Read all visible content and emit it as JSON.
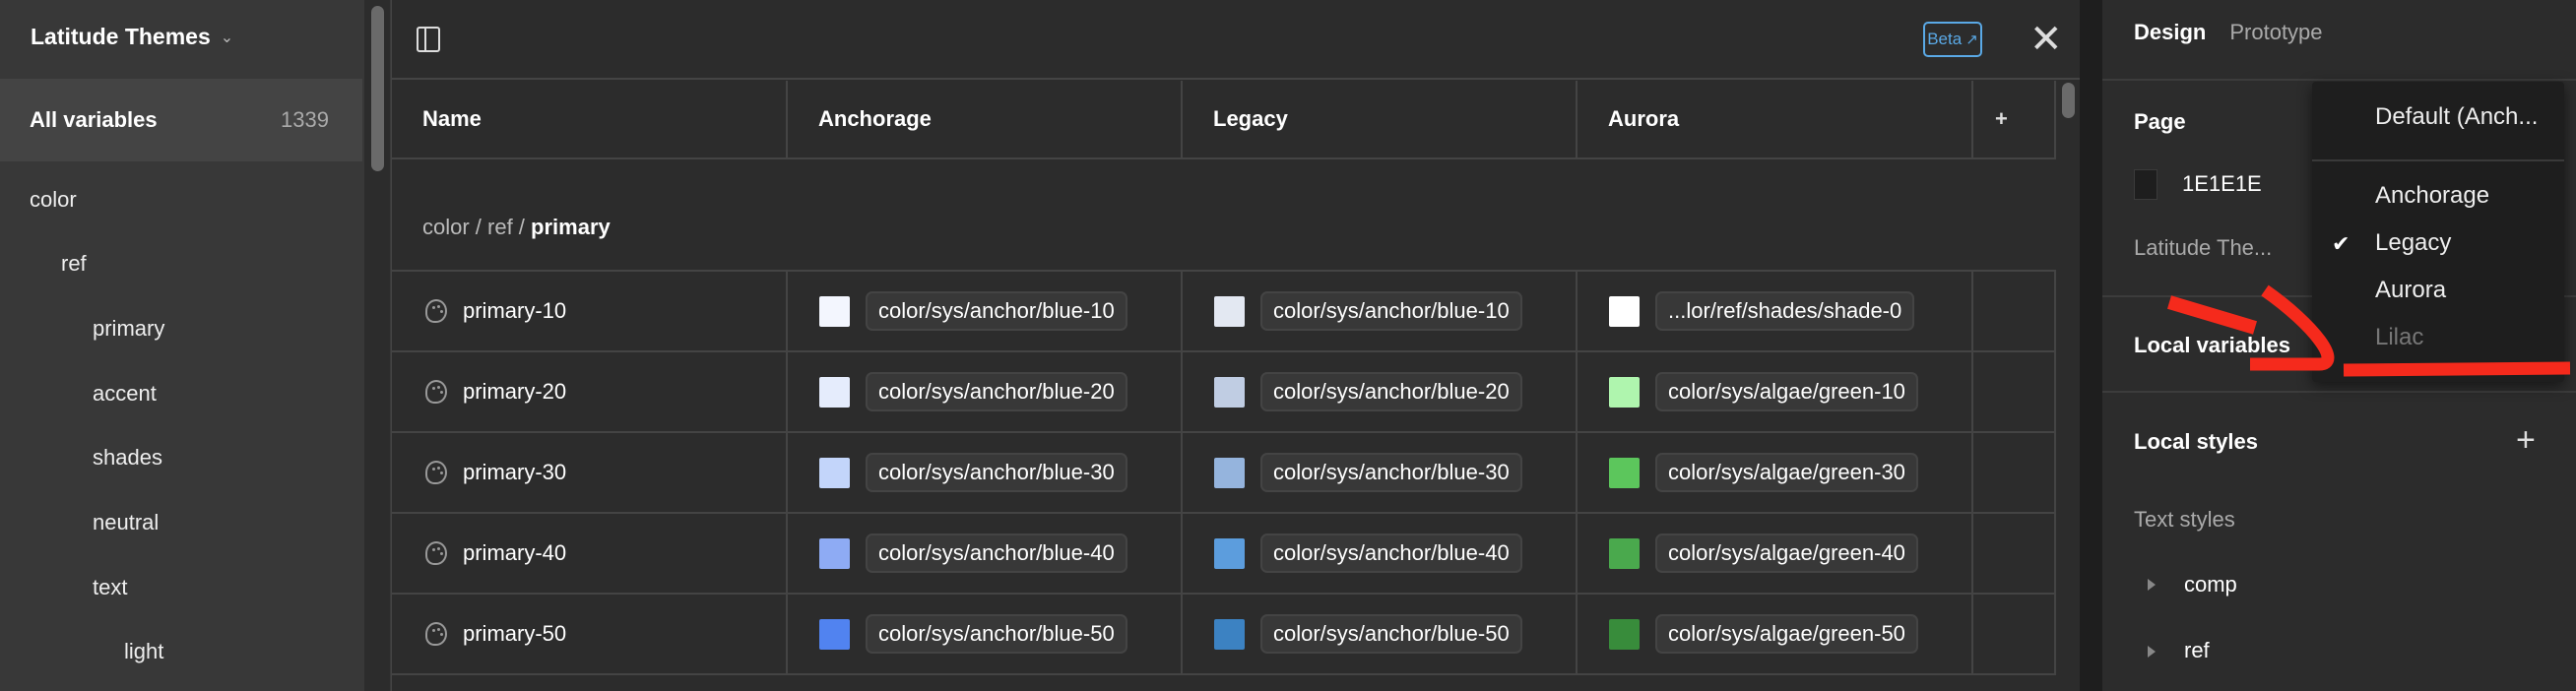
{
  "sidebar": {
    "title": "Latitude Themes",
    "all_variables": {
      "label": "All variables",
      "count": "1339"
    },
    "tree": [
      {
        "label": "color",
        "level": 0
      },
      {
        "label": "ref",
        "level": 1
      },
      {
        "label": "primary",
        "level": 2
      },
      {
        "label": "accent",
        "level": 2
      },
      {
        "label": "shades",
        "level": 2
      },
      {
        "label": "neutral",
        "level": 2
      },
      {
        "label": "text",
        "level": 2
      },
      {
        "label": "light",
        "level": 3
      }
    ]
  },
  "main": {
    "beta_label": "Beta",
    "columns": [
      "Name",
      "Anchorage",
      "Legacy",
      "Aurora"
    ],
    "add_mode_icon": "+",
    "group": {
      "prefix": "color / ref / ",
      "name": "primary"
    },
    "rows": [
      {
        "name": "primary-10",
        "values": [
          {
            "swatch": "#f3f6fe",
            "ref": "color/sys/anchor/blue-10"
          },
          {
            "swatch": "#e3e8f2",
            "ref": "color/sys/anchor/blue-10"
          },
          {
            "swatch": "#ffffff",
            "ref": "...lor/ref/shades/shade-0"
          }
        ]
      },
      {
        "name": "primary-20",
        "values": [
          {
            "swatch": "#e5ecfc",
            "ref": "color/sys/anchor/blue-20"
          },
          {
            "swatch": "#c0cde3",
            "ref": "color/sys/anchor/blue-20"
          },
          {
            "swatch": "#aff5ae",
            "ref": "color/sys/algae/green-10"
          }
        ]
      },
      {
        "name": "primary-30",
        "values": [
          {
            "swatch": "#c3d5fa",
            "ref": "color/sys/anchor/blue-30"
          },
          {
            "swatch": "#95b4dd",
            "ref": "color/sys/anchor/blue-30"
          },
          {
            "swatch": "#5cc65c",
            "ref": "color/sys/algae/green-30"
          }
        ]
      },
      {
        "name": "primary-40",
        "values": [
          {
            "swatch": "#8eabf4",
            "ref": "color/sys/anchor/blue-40"
          },
          {
            "swatch": "#5c9ddd",
            "ref": "color/sys/anchor/blue-40"
          },
          {
            "swatch": "#4aa94d",
            "ref": "color/sys/algae/green-40"
          }
        ]
      },
      {
        "name": "primary-50",
        "values": [
          {
            "swatch": "#5183f0",
            "ref": "color/sys/anchor/blue-50"
          },
          {
            "swatch": "#3c82c2",
            "ref": "color/sys/anchor/blue-50"
          },
          {
            "swatch": "#388c3b",
            "ref": "color/sys/algae/green-50"
          }
        ]
      }
    ]
  },
  "right_panel": {
    "tabs": [
      "Design",
      "Prototype"
    ],
    "page_label": "Page",
    "page_color": "1E1E1E",
    "collection_label": "Latitude The...",
    "local_variables": "Local variables",
    "local_styles": "Local styles",
    "text_styles": "Text styles",
    "style_groups": [
      "comp",
      "ref"
    ]
  },
  "mode_menu": {
    "default": "Default (Anch...",
    "options": [
      {
        "label": "Anchorage",
        "checked": false,
        "disabled": false
      },
      {
        "label": "Legacy",
        "checked": true,
        "disabled": false
      },
      {
        "label": "Aurora",
        "checked": false,
        "disabled": false
      },
      {
        "label": "Lilac",
        "checked": false,
        "disabled": true
      }
    ]
  },
  "colors": {
    "accent": "#5aa9e6",
    "annotation": "#f52a1c"
  }
}
